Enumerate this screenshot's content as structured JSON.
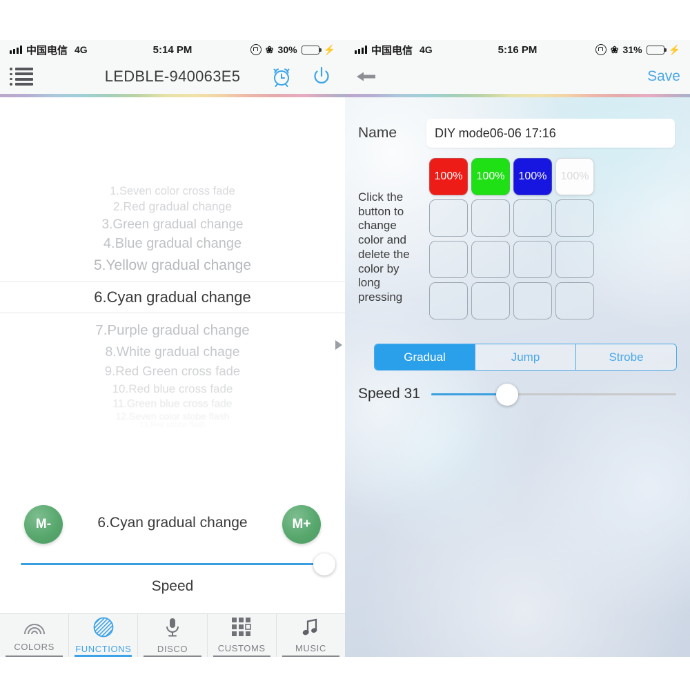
{
  "left": {
    "status": {
      "carrier": "中国电信",
      "network": "4G",
      "time": "5:14 PM",
      "battery_pct": "30%",
      "battery_level": 46
    },
    "nav": {
      "title": "LEDBLE-940063E5",
      "menu_icon": "list-menu-icon",
      "alarm_icon": "alarm-clock-icon",
      "power_icon": "power-icon"
    },
    "modes": [
      {
        "label": "1.Seven color cross fade",
        "selected": false
      },
      {
        "label": "2.Red  gradual change",
        "selected": false
      },
      {
        "label": "3.Green gradual change",
        "selected": false
      },
      {
        "label": "4.Blue gradual change",
        "selected": false
      },
      {
        "label": "5.Yellow gradual change",
        "selected": false
      },
      {
        "label": "6.Cyan gradual change",
        "selected": true
      },
      {
        "label": "7.Purple gradual change",
        "selected": false
      },
      {
        "label": "8.White gradual chage",
        "selected": false
      },
      {
        "label": "9.Red Green cross fade",
        "selected": false
      },
      {
        "label": "10.Red blue cross fade",
        "selected": false
      },
      {
        "label": "11.Green blue cross fade",
        "selected": false
      },
      {
        "label": "12.Seven color stobe flash",
        "selected": false
      },
      {
        "label": "13.Red strobe flash",
        "selected": false
      }
    ],
    "controls": {
      "mode_prev": "M-",
      "mode_next": "M+",
      "current_mode": "6.Cyan gradual change",
      "speed_label": "Speed",
      "speed_value": 100
    },
    "tabs": [
      {
        "label": "COLORS",
        "icon": "rainbow-icon",
        "active": false
      },
      {
        "label": "FUNCTIONS",
        "icon": "hatched-circle-icon",
        "active": true
      },
      {
        "label": "DISCO",
        "icon": "microphone-icon",
        "active": false
      },
      {
        "label": "CUSTOMS",
        "icon": "grid-icon",
        "active": false
      },
      {
        "label": "MUSIC",
        "icon": "music-note-icon",
        "active": false
      }
    ],
    "tab_more_icon": "chevron-right-icon"
  },
  "right": {
    "status": {
      "carrier": "中国电信",
      "network": "4G",
      "time": "5:16 PM",
      "battery_pct": "31%",
      "battery_level": 48
    },
    "nav": {
      "back_icon": "back-arrow-icon",
      "save_label": "Save"
    },
    "name": {
      "label": "Name",
      "value": "DIY mode06-06 17:16",
      "placeholder": "DIY mode"
    },
    "hint": "Click the button to change color and delete the color by long pressing",
    "grid": [
      {
        "label": "100%",
        "color": "#ee1c16",
        "text_color": "#ffffff",
        "filled": true
      },
      {
        "label": "100%",
        "color": "#1ee014",
        "text_color": "#ffffff",
        "filled": true
      },
      {
        "label": "100%",
        "color": "#1616e0",
        "text_color": "#ffffff",
        "filled": true
      },
      {
        "label": "100%",
        "color": "#fdfdfd",
        "text_color": "#d9d9d9",
        "filled": true
      },
      {
        "label": "",
        "color": "",
        "text_color": "",
        "filled": false
      },
      {
        "label": "",
        "color": "",
        "text_color": "",
        "filled": false
      },
      {
        "label": "",
        "color": "",
        "text_color": "",
        "filled": false
      },
      {
        "label": "",
        "color": "",
        "text_color": "",
        "filled": false
      },
      {
        "label": "",
        "color": "",
        "text_color": "",
        "filled": false
      },
      {
        "label": "",
        "color": "",
        "text_color": "",
        "filled": false
      },
      {
        "label": "",
        "color": "",
        "text_color": "",
        "filled": false
      },
      {
        "label": "",
        "color": "",
        "text_color": "",
        "filled": false
      },
      {
        "label": "",
        "color": "",
        "text_color": "",
        "filled": false
      },
      {
        "label": "",
        "color": "",
        "text_color": "",
        "filled": false
      },
      {
        "label": "",
        "color": "",
        "text_color": "",
        "filled": false
      },
      {
        "label": "",
        "color": "",
        "text_color": "",
        "filled": false
      }
    ],
    "modes": [
      {
        "label": "Gradual",
        "active": true
      },
      {
        "label": "Jump",
        "active": false
      },
      {
        "label": "Strobe",
        "active": false
      }
    ],
    "speed": {
      "label": "Speed  31",
      "value": 31
    }
  },
  "colors": {
    "accent": "#4aa8e8",
    "segment_active": "#2ba0ea",
    "mbtn_green": "#58a86e",
    "selected_text": "#3a3a3a",
    "dim_text": "#b9bcc1"
  }
}
